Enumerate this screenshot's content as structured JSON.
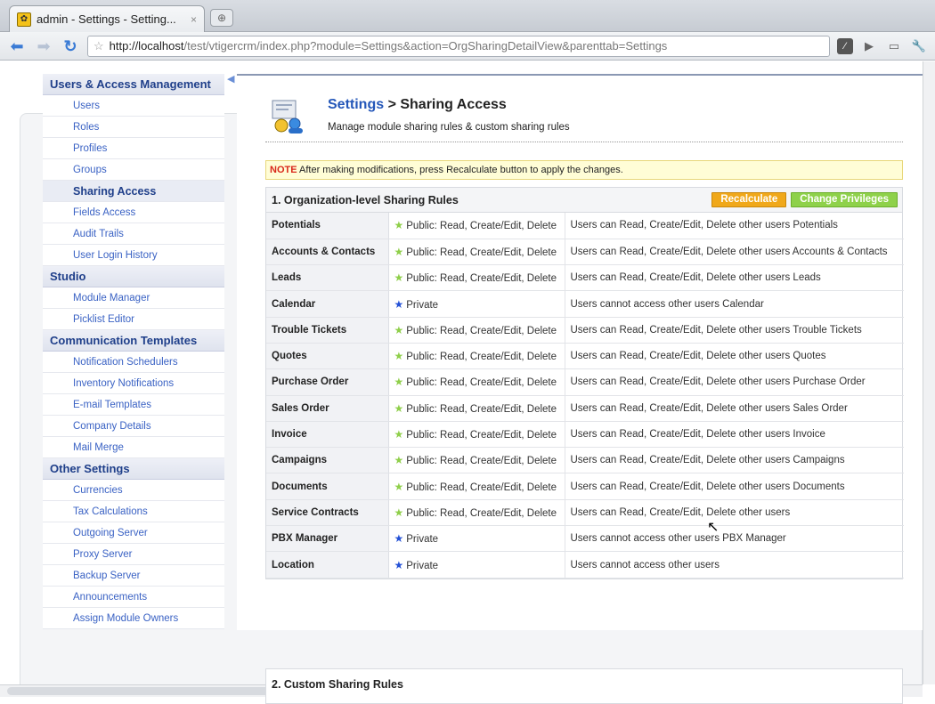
{
  "browser": {
    "tab_title": "admin - Settings - Setting...",
    "tab_close": "×",
    "newtab": "⊕",
    "url_host": "http://localhost",
    "url_path": "/test/vtigercrm/index.php?module=Settings&action=OrgSharingDetailView&parenttab=Settings"
  },
  "sidebar": {
    "sections": [
      {
        "title": "Users & Access Management",
        "items": [
          {
            "label": "Users"
          },
          {
            "label": "Roles"
          },
          {
            "label": "Profiles"
          },
          {
            "label": "Groups"
          },
          {
            "label": "Sharing Access",
            "active": true
          },
          {
            "label": "Fields Access"
          },
          {
            "label": "Audit Trails"
          },
          {
            "label": "User Login History"
          }
        ]
      },
      {
        "title": "Studio",
        "items": [
          {
            "label": "Module Manager"
          },
          {
            "label": "Picklist Editor"
          }
        ]
      },
      {
        "title": "Communication Templates",
        "items": [
          {
            "label": "Notification Schedulers"
          },
          {
            "label": "Inventory Notifications"
          },
          {
            "label": "E-mail Templates"
          },
          {
            "label": "Company Details"
          },
          {
            "label": "Mail Merge"
          }
        ]
      },
      {
        "title": "Other Settings",
        "items": [
          {
            "label": "Currencies"
          },
          {
            "label": "Tax Calculations"
          },
          {
            "label": "Outgoing Server"
          },
          {
            "label": "Proxy Server"
          },
          {
            "label": "Backup Server"
          },
          {
            "label": "Announcements"
          },
          {
            "label": "Assign Module Owners"
          }
        ]
      }
    ]
  },
  "header": {
    "crumb_link": "Settings",
    "crumb_rest": " > Sharing Access",
    "subtitle": "Manage module sharing rules & custom sharing rules"
  },
  "note": {
    "keyword": "NOTE",
    "text": " After making modifications, press Recalculate button to apply the changes."
  },
  "org_rules": {
    "title": "1. Organization-level Sharing Rules",
    "recalculate_label": "Recalculate",
    "change_privileges_label": "Change Privileges",
    "rows": [
      {
        "module": "Potentials",
        "type": "public",
        "permission": "Public: Read, Create/Edit, Delete",
        "description": "Users can Read, Create/Edit, Delete other users Potentials"
      },
      {
        "module": "Accounts & Contacts",
        "type": "public",
        "permission": "Public: Read, Create/Edit, Delete",
        "description": "Users can Read, Create/Edit, Delete other users Accounts & Contacts"
      },
      {
        "module": "Leads",
        "type": "public",
        "permission": "Public: Read, Create/Edit, Delete",
        "description": "Users can Read, Create/Edit, Delete other users Leads"
      },
      {
        "module": "Calendar",
        "type": "private",
        "permission": "Private",
        "description": "Users cannot access other users Calendar"
      },
      {
        "module": "Trouble Tickets",
        "type": "public",
        "permission": "Public: Read, Create/Edit, Delete",
        "description": "Users can Read, Create/Edit, Delete other users Trouble Tickets"
      },
      {
        "module": "Quotes",
        "type": "public",
        "permission": "Public: Read, Create/Edit, Delete",
        "description": "Users can Read, Create/Edit, Delete other users Quotes"
      },
      {
        "module": "Purchase Order",
        "type": "public",
        "permission": "Public: Read, Create/Edit, Delete",
        "description": "Users can Read, Create/Edit, Delete other users Purchase Order"
      },
      {
        "module": "Sales Order",
        "type": "public",
        "permission": "Public: Read, Create/Edit, Delete",
        "description": "Users can Read, Create/Edit, Delete other users Sales Order"
      },
      {
        "module": "Invoice",
        "type": "public",
        "permission": "Public: Read, Create/Edit, Delete",
        "description": "Users can Read, Create/Edit, Delete other users Invoice"
      },
      {
        "module": "Campaigns",
        "type": "public",
        "permission": "Public: Read, Create/Edit, Delete",
        "description": "Users can Read, Create/Edit, Delete other users Campaigns"
      },
      {
        "module": "Documents",
        "type": "public",
        "permission": "Public: Read, Create/Edit, Delete",
        "description": "Users can Read, Create/Edit, Delete other users Documents"
      },
      {
        "module": "Service Contracts",
        "type": "public",
        "permission": "Public: Read, Create/Edit, Delete",
        "description": "Users can Read, Create/Edit, Delete other users"
      },
      {
        "module": "PBX Manager",
        "type": "private",
        "permission": "Private",
        "description": "Users cannot access other users PBX Manager"
      },
      {
        "module": "Location",
        "type": "private",
        "permission": "Private",
        "description": "Users cannot access other users"
      }
    ]
  },
  "custom_rules": {
    "title": "2. Custom Sharing Rules"
  },
  "colors": {
    "public_star": "#8fcf4a",
    "private_star": "#2451d6",
    "recalculate": "#f0a81a",
    "change_privileges": "#8ed14a"
  }
}
